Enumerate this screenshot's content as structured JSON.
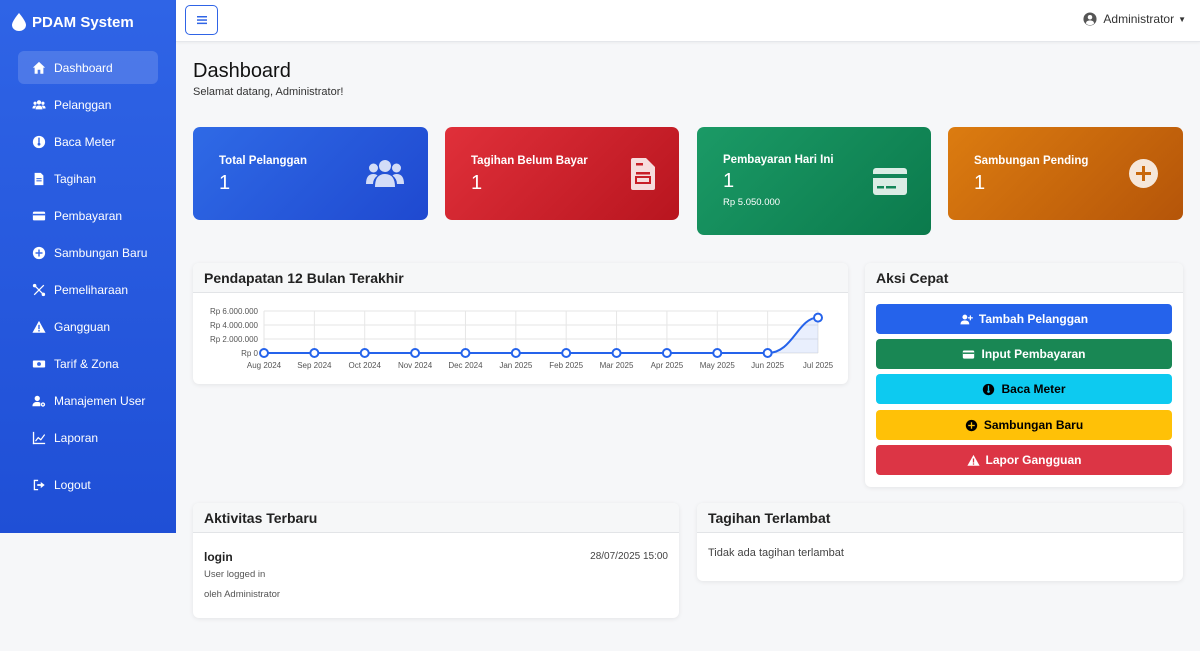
{
  "brand": {
    "name": "PDAM System"
  },
  "sidebar": {
    "items": [
      {
        "label": "Dashboard",
        "icon": "home-icon",
        "active": true
      },
      {
        "label": "Pelanggan",
        "icon": "users-icon"
      },
      {
        "label": "Baca Meter",
        "icon": "gauge-icon"
      },
      {
        "label": "Tagihan",
        "icon": "invoice-icon"
      },
      {
        "label": "Pembayaran",
        "icon": "credit-card-icon"
      },
      {
        "label": "Sambungan Baru",
        "icon": "plus-circle-icon"
      },
      {
        "label": "Pemeliharaan",
        "icon": "tools-icon"
      },
      {
        "label": "Gangguan",
        "icon": "warning-icon"
      },
      {
        "label": "Tarif & Zona",
        "icon": "money-icon"
      },
      {
        "label": "Manajemen User",
        "icon": "user-cog-icon"
      },
      {
        "label": "Laporan",
        "icon": "chart-icon"
      }
    ],
    "logout": "Logout"
  },
  "topbar": {
    "user": "Administrator"
  },
  "header": {
    "title": "Dashboard",
    "subtitle": "Selamat datang, Administrator!"
  },
  "cards": [
    {
      "label": "Total Pelanggan",
      "value": "1",
      "color": "#2563eb"
    },
    {
      "label": "Tagihan Belum Bayar",
      "value": "1",
      "color": "#dc2626"
    },
    {
      "label": "Pembayaran Hari Ini",
      "value": "1",
      "extra": "Rp 5.050.000",
      "color": "#15925f"
    },
    {
      "label": "Sambungan Pending",
      "value": "1",
      "color": "#d97706"
    }
  ],
  "chart_panel": {
    "title": "Pendapatan 12 Bulan Terakhir"
  },
  "chart_data": {
    "type": "line",
    "categories": [
      "Aug 2024",
      "Sep 2024",
      "Oct 2024",
      "Nov 2024",
      "Dec 2024",
      "Jan 2025",
      "Feb 2025",
      "Mar 2025",
      "Apr 2025",
      "May 2025",
      "Jun 2025",
      "Jul 2025"
    ],
    "values": [
      0,
      0,
      0,
      0,
      0,
      0,
      0,
      0,
      0,
      0,
      0,
      5050000
    ],
    "yticks": [
      "Rp 0",
      "Rp 2.000.000",
      "Rp 4.000.000",
      "Rp 6.000.000"
    ],
    "ylim": [
      0,
      6000000
    ],
    "line_color": "#2563eb",
    "grid": true
  },
  "quick_actions": {
    "title": "Aksi Cepat",
    "buttons": [
      {
        "label": "Tambah Pelanggan",
        "bg": "#2563eb",
        "fg": "#ffffff",
        "icon": "user-plus-icon"
      },
      {
        "label": "Input Pembayaran",
        "bg": "#198754",
        "fg": "#ffffff",
        "icon": "credit-card-icon"
      },
      {
        "label": "Baca Meter",
        "bg": "#0dcaf0",
        "fg": "#000000",
        "icon": "gauge-icon"
      },
      {
        "label": "Sambungan Baru",
        "bg": "#ffc107",
        "fg": "#000000",
        "icon": "plus-circle-icon"
      },
      {
        "label": "Lapor Gangguan",
        "bg": "#dc3545",
        "fg": "#ffffff",
        "icon": "warning-icon"
      }
    ]
  },
  "activity": {
    "title": "Aktivitas Terbaru",
    "items": [
      {
        "action": "login",
        "time": "28/07/2025 15:00",
        "desc": "User logged in",
        "by": "oleh Administrator"
      }
    ]
  },
  "overdue": {
    "title": "Tagihan Terlambat",
    "empty": "Tidak ada tagihan terlambat"
  }
}
